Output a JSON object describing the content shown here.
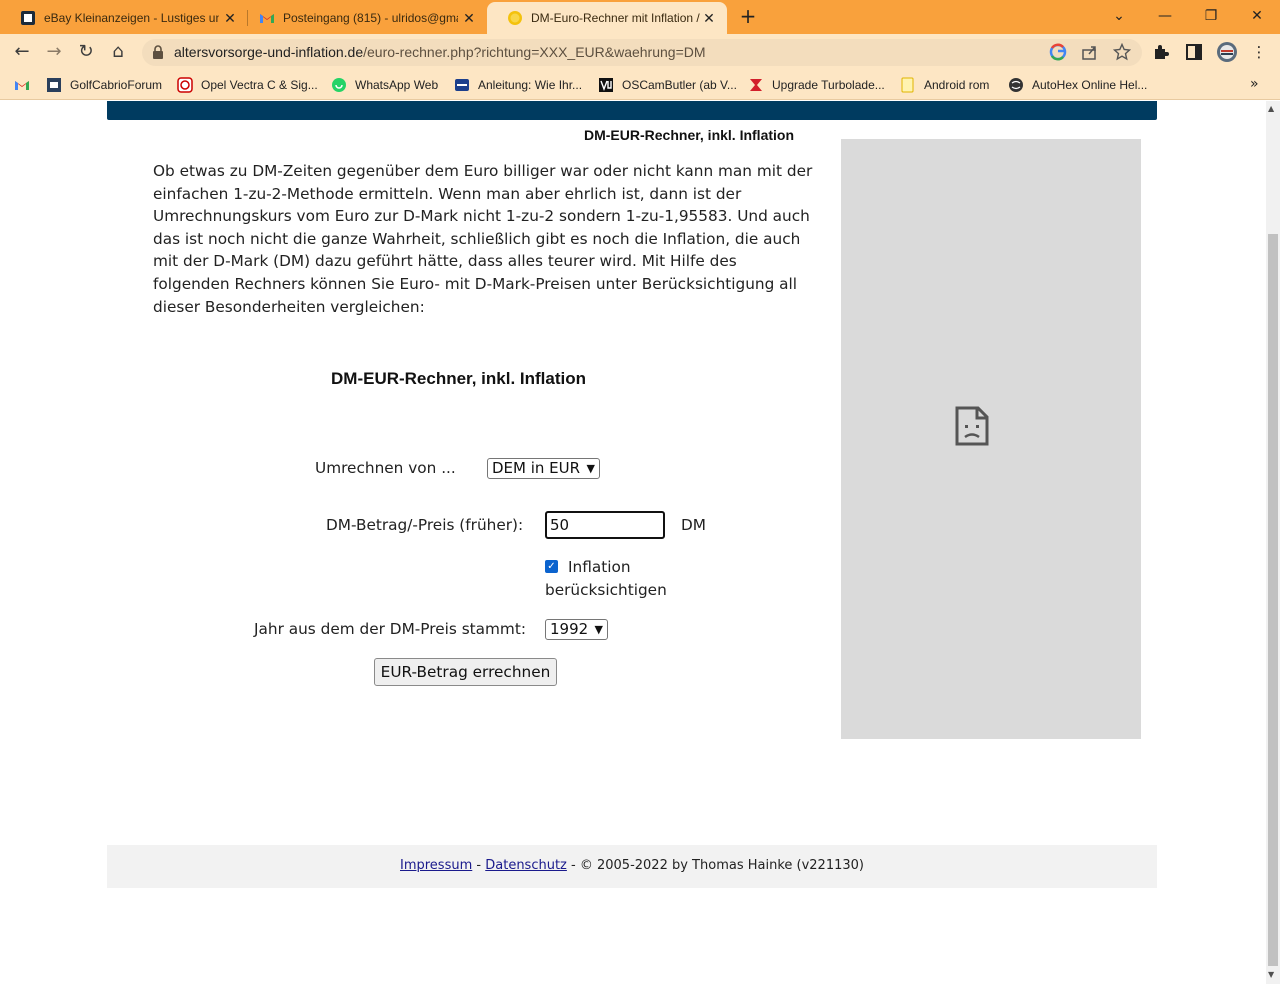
{
  "browser": {
    "tabs": [
      {
        "title": "eBay Kleinanzeigen - Lustiges un",
        "active": false,
        "icon": "ebay-favicon"
      },
      {
        "title": "Posteingang (815) - ulridos@gma",
        "active": false,
        "icon": "gmail-favicon"
      },
      {
        "title": "DM-Euro-Rechner mit Inflation / ",
        "active": true,
        "icon": "coin-favicon"
      }
    ],
    "new_tab": "+",
    "window_controls": {
      "dropdown": "⌄",
      "minimize": "—",
      "restore": "❐",
      "close": "✕"
    },
    "nav": {
      "back": "←",
      "forward": "→",
      "reload": "↻",
      "home": "⌂"
    },
    "url_host": "altersvorsorge-und-inflation.de",
    "url_path": "/euro-rechner.php?richtung=XXX_EUR&waehrung=DM",
    "bookmarks": [
      {
        "label": "",
        "icon": "gmail-icon"
      },
      {
        "label": "GolfCabrioForum",
        "icon": "forum-icon"
      },
      {
        "label": "Opel Vectra C & Sig...",
        "icon": "opel-icon"
      },
      {
        "label": "WhatsApp Web",
        "icon": "whatsapp-icon"
      },
      {
        "label": "Anleitung: Wie Ihr...",
        "icon": "deb-icon"
      },
      {
        "label": "OSCamButler (ab V...",
        "icon": "vu-icon"
      },
      {
        "label": "Upgrade Turbolade...",
        "icon": "turbo-icon"
      },
      {
        "label": "Android rom",
        "icon": "folder-icon"
      },
      {
        "label": "AutoHex Online Hel...",
        "icon": "globe-icon"
      }
    ],
    "bookmarks_more": "»"
  },
  "page": {
    "breadcrumb": "DM-EUR-Rechner, inkl. Inflation",
    "intro": "Ob etwas zu DM-Zeiten gegenüber dem Euro billiger war oder nicht kann man mit der einfachen 1-zu-2-Methode ermitteln. Wenn man aber ehrlich ist, dann ist der Umrechnungskurs vom Euro zur D-Mark nicht 1-zu-2 sondern 1-zu-1,95583. Und auch das ist noch nicht die ganze Wahrheit, schließlich gibt es noch die Inflation, die auch mit der D-Mark (DM) dazu geführt hätte, dass alles teurer wird. Mit Hilfe des folgenden Rechners können Sie Euro- mit D-Mark-Preisen unter Berücksichtigung all dieser Besonderheiten vergleichen:",
    "calc_title": "DM-EUR-Rechner, inkl. Inflation",
    "form": {
      "convert_label": "Umrechnen von ...",
      "convert_value": "DEM in EUR",
      "amount_label": "DM-Betrag/-Preis (früher):",
      "amount_value": "50",
      "amount_unit": "DM",
      "inflation_label_1": "Inflation",
      "inflation_label_2": "berücksichtigen",
      "inflation_checked": true,
      "year_label": "Jahr aus dem der DM-Preis stammt:",
      "year_value": "1992",
      "submit_label": "EUR-Betrag errechnen"
    },
    "footer": {
      "impressum": "Impressum",
      "sep": "-",
      "datenschutz": "Datenschutz",
      "copyright": "- © 2005-2022 by Thomas Hainke (v221130)"
    }
  },
  "colors": {
    "tabstrip": "#f9a13c",
    "toolbar": "#fde6c4",
    "header": "#003b60",
    "checkbox": "#0b63ce"
  }
}
